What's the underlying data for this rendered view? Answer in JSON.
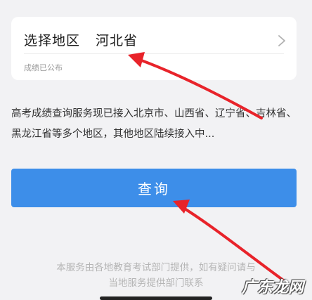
{
  "region_card": {
    "label": "选择地区",
    "value": "河北省",
    "status": "成绩已公布",
    "chevron_icon": "chevron-right-icon"
  },
  "description": "高考成绩查询服务现已接入北京市、山西省、辽宁省、吉林省、黑龙江省等多个地区，其他地区陆续接入中...",
  "query_button": {
    "label": "查询"
  },
  "footer": {
    "line1": "本服务由各地教育考试部门提供，如有疑问请与",
    "line2": "当地服务提供部门联系"
  },
  "watermark": {
    "text": "广东龙网"
  },
  "colors": {
    "background": "#f2f2f4",
    "button": "#3d8ee9",
    "annotation_arrow": "#e8232a"
  }
}
